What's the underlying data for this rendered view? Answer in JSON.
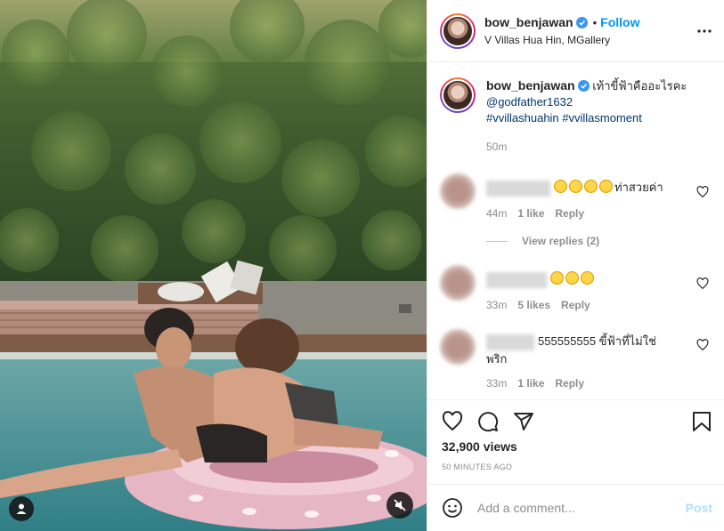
{
  "post": {
    "author": "bow_benjawan",
    "follow_label": "Follow",
    "location": "V Villas Hua Hin, MGallery",
    "caption_text": "เท้าขี้ฟ้าคืออะไรคะ",
    "mention": "@godfather1632",
    "hashtags": "#vvillashuahin #vvillasmoment",
    "caption_time": "50m"
  },
  "comments": [
    {
      "text": "ท่าสวยค่า",
      "time": "44m",
      "likes": "1 like",
      "reply_label": "Reply",
      "emoji_count": 4
    },
    {
      "text": "",
      "time": "33m",
      "likes": "5 likes",
      "reply_label": "Reply",
      "emoji_count": 3
    },
    {
      "text": "555555555 ขี้ฟ้าที่ไม่ใช่พริก",
      "time": "33m",
      "likes": "1 like",
      "reply_label": "Reply",
      "emoji_count": 0
    }
  ],
  "view_replies_label": "View replies (2)",
  "stats": {
    "views": "32,900 views",
    "time_ago": "50 MINUTES AGO"
  },
  "add_comment": {
    "placeholder": "Add a comment...",
    "post_label": "Post"
  },
  "icons": {
    "like": "heart-icon",
    "comment": "comment-icon",
    "share": "share-icon",
    "save": "bookmark-icon",
    "more": "more-icon",
    "emoji": "emoji-icon",
    "mute": "mute-icon",
    "user_tag": "user-icon",
    "verified": "verified-badge-icon"
  },
  "colors": {
    "accent": "#0095f6",
    "post_disabled": "#b2dffc",
    "verified": "#3897f0"
  }
}
